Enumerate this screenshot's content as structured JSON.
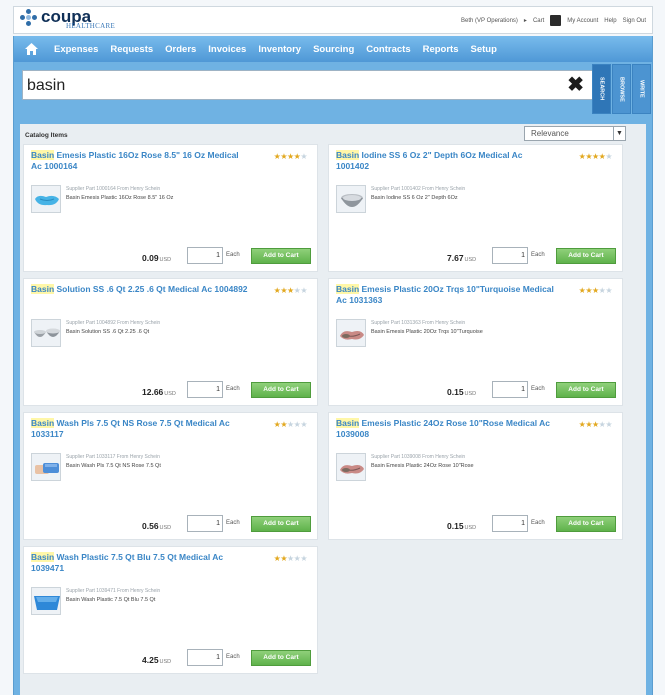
{
  "header": {
    "logo_text": "coupa",
    "logo_sub": "HEALTHCARE",
    "user_context": "Beth (VP Operations)",
    "cart_label": "Cart",
    "my_account": "My Account",
    "help": "Help",
    "sign_out": "Sign Out"
  },
  "nav": {
    "items": [
      {
        "label": "Expenses"
      },
      {
        "label": "Requests"
      },
      {
        "label": "Orders"
      },
      {
        "label": "Invoices"
      },
      {
        "label": "Inventory"
      },
      {
        "label": "Sourcing"
      },
      {
        "label": "Contracts"
      },
      {
        "label": "Reports"
      },
      {
        "label": "Setup"
      }
    ]
  },
  "search": {
    "value": "basin",
    "clear_icon": "close-icon"
  },
  "side_tabs": [
    "SEARCH",
    "BROWSE",
    "WRITE"
  ],
  "results": {
    "title": "Catalog Items",
    "sort_value": "Relevance"
  },
  "items": [
    {
      "title_hl": "Basin",
      "title_rest": " Emesis Plastic 16Oz Rose 8.5\" 16 Oz Medical Ac 1000164",
      "supplier": "Supplier Part 1000164 From Henry Schein",
      "desc": "Basin Emesis Plastic 16Oz Rose 8.5\" 16 Oz",
      "price": "0.09",
      "currency": "USD",
      "qty": "1",
      "unit": "Each",
      "button": "Add to Cart",
      "rating": 4,
      "icon": "emesis-basin-blue-icon"
    },
    {
      "title_hl": "Basin",
      "title_rest": " Iodine SS 6 Oz 2\" Depth 6Oz Medical Ac 1001402",
      "supplier": "Supplier Part 1001402 From Henry Schein",
      "desc": "Basin Iodine SS 6 Oz 2\" Depth 6Oz",
      "price": "7.67",
      "currency": "USD",
      "qty": "1",
      "unit": "Each",
      "button": "Add to Cart",
      "rating": 4,
      "icon": "steel-bowl-icon"
    },
    {
      "title_hl": "Basin",
      "title_rest": " Solution SS .6 Qt 2.25 .6 Qt Medical Ac 1004892",
      "supplier": "Supplier Part 1004892 From Henry Schein",
      "desc": "Basin Solution SS .6 Qt 2.25 .6 Qt",
      "price": "12.66",
      "currency": "USD",
      "qty": "1",
      "unit": "Each",
      "button": "Add to Cart",
      "rating": 3,
      "icon": "steel-basins-icon"
    },
    {
      "title_hl": "Basin",
      "title_rest": " Emesis Plastic 20Oz Trqs 10\"Turquoise Medical Ac 1031363",
      "supplier": "Supplier Part 1031363 From Henry Schein",
      "desc": "Basin Emesis Plastic 20Oz Trqs 10\"Turquoise",
      "price": "0.15",
      "currency": "USD",
      "qty": "1",
      "unit": "Each",
      "button": "Add to Cart",
      "rating": 3,
      "icon": "emesis-basin-rose-icon"
    },
    {
      "title_hl": "Basin",
      "title_rest": " Wash Pls 7.5 Qt NS Rose 7.5 Qt Medical Ac 1033117",
      "supplier": "Supplier Part 1033117 From Henry Schein",
      "desc": "Basin Wash Pls 7.5 Qt NS Rose 7.5 Qt",
      "price": "0.56",
      "currency": "USD",
      "qty": "1",
      "unit": "Each",
      "button": "Add to Cart",
      "rating": 2,
      "icon": "wash-basins-icon"
    },
    {
      "title_hl": "Basin",
      "title_rest": " Emesis Plastic 24Oz Rose 10\"Rose Medical Ac 1039008",
      "supplier": "Supplier Part 1039008 From Henry Schein",
      "desc": "Basin Emesis Plastic 24Oz Rose 10\"Rose",
      "price": "0.15",
      "currency": "USD",
      "qty": "1",
      "unit": "Each",
      "button": "Add to Cart",
      "rating": 3,
      "icon": "emesis-basin-rose-icon"
    },
    {
      "title_hl": "Basin",
      "title_rest": " Wash Plastic 7.5 Qt Blu 7.5 Qt Medical Ac 1039471",
      "supplier": "Supplier Part 1039471 From Henry Schein",
      "desc": "Basin Wash Plastic 7.5 Qt Blu 7.5 Qt",
      "price": "4.25",
      "currency": "USD",
      "qty": "1",
      "unit": "Each",
      "button": "Add to Cart",
      "rating": 2,
      "icon": "blue-tub-icon"
    }
  ],
  "colors": {
    "nav_blue": "#4f98d6",
    "title_blue": "#3a86c6",
    "highlight": "#fff7a8",
    "star_on": "#e2a81f",
    "star_off": "#c6d4df",
    "add_green": "#5fb24b"
  }
}
